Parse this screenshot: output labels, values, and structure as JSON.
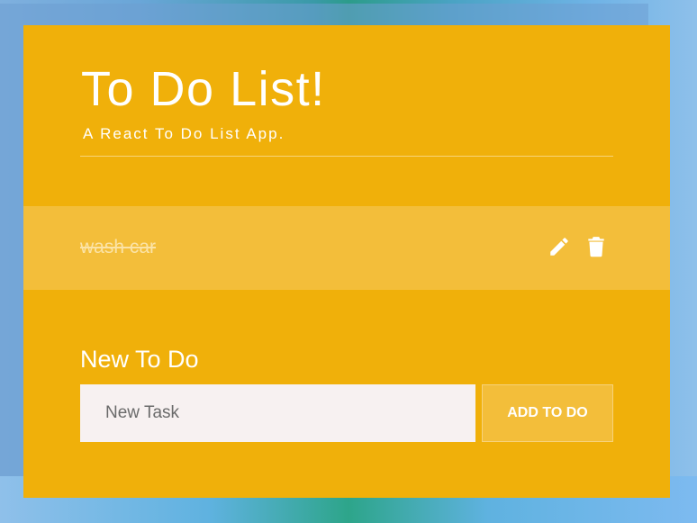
{
  "app": {
    "title": "To Do List!",
    "subtitle": "A React To Do List App."
  },
  "todos": [
    {
      "text": "wash car",
      "completed": true
    }
  ],
  "icons": {
    "edit": "pencil-icon",
    "delete": "trash-icon"
  },
  "new_todo": {
    "label": "New To Do",
    "placeholder": "New Task",
    "value": "",
    "button_label": "ADD TO DO"
  },
  "colors": {
    "card_background": "#f0b00a",
    "todo_row_background": "#f3be3a",
    "input_background": "#f7f1f1",
    "text": "#ffffff"
  }
}
